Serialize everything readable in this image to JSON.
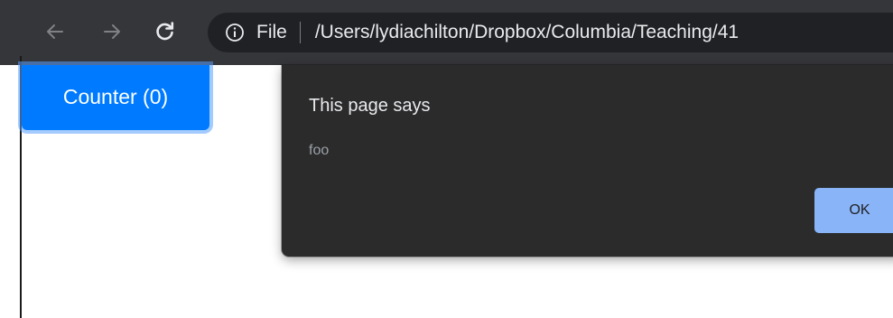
{
  "browser": {
    "scheme_label": "File",
    "url": "/Users/lydiachilton/Dropbox/Columbia/Teaching/41",
    "icons": {
      "back": "arrow-left",
      "forward": "arrow-right",
      "reload": "reload",
      "info": "info-circle"
    }
  },
  "page": {
    "counter_label": "Counter (0)"
  },
  "dialog": {
    "title": "This page says",
    "message": "foo",
    "ok_label": "OK"
  },
  "colors": {
    "toolbar_bg": "#35363a",
    "omnibox_bg": "#202124",
    "counter_button": "#007bff",
    "dialog_bg": "#2b2b2b",
    "ok_button": "#8ab4f8"
  }
}
